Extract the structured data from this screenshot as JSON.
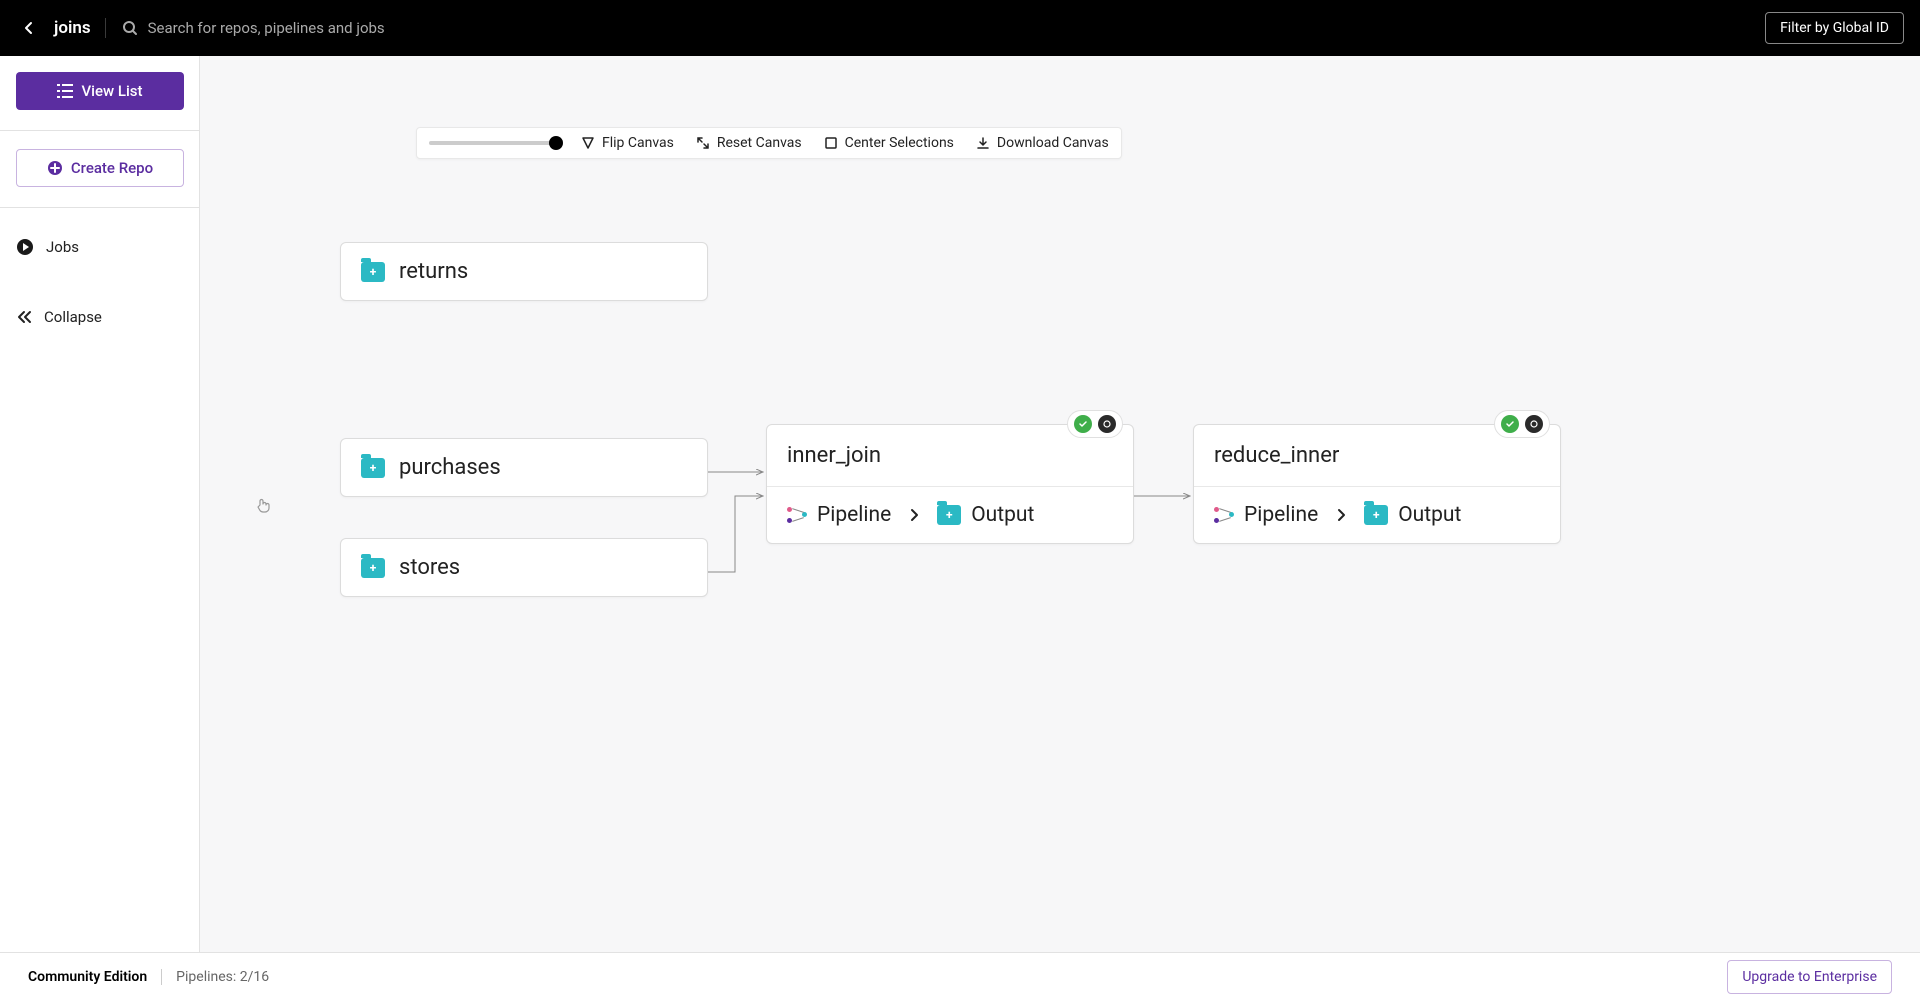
{
  "header": {
    "title": "joins",
    "search_placeholder": "Search for repos, pipelines and jobs",
    "filter_button": "Filter by Global ID"
  },
  "sidebar": {
    "view_list": "View List",
    "create_repo": "Create Repo",
    "jobs": "Jobs",
    "collapse": "Collapse"
  },
  "toolbar": {
    "flip": "Flip Canvas",
    "reset": "Reset Canvas",
    "center": "Center Selections",
    "download": "Download Canvas"
  },
  "canvas": {
    "repos": {
      "returns": "returns",
      "purchases": "purchases",
      "stores": "stores"
    },
    "pipelines": {
      "inner_join": {
        "title": "inner_join",
        "pipeline_label": "Pipeline",
        "output_label": "Output"
      },
      "reduce_inner": {
        "title": "reduce_inner",
        "pipeline_label": "Pipeline",
        "output_label": "Output"
      }
    }
  },
  "footer": {
    "edition": "Community Edition",
    "pipelines": "Pipelines: 2/16",
    "upgrade": "Upgrade to Enterprise"
  }
}
